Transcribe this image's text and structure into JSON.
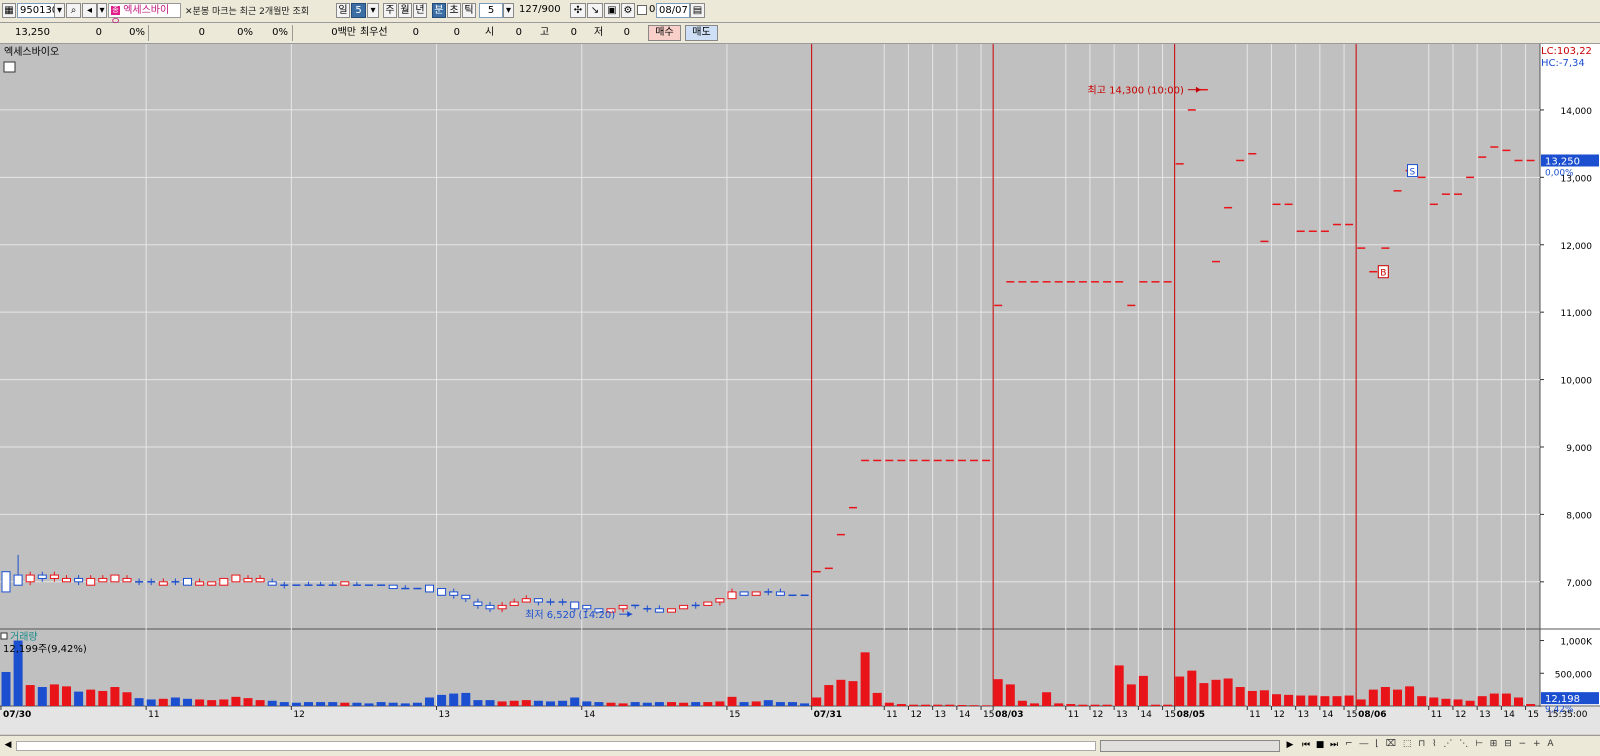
{
  "toolbar": {
    "code": "950130",
    "stock_name": "엑세스바이오",
    "notice": "분봉 마크는 최근 2개월만 조회",
    "period_buttons": [
      "일",
      "5",
      "주",
      "월",
      "년",
      "분",
      "초",
      "틱",
      "5"
    ],
    "count": "127",
    "count_max": "/900",
    "date_check": "0",
    "date": "08/07"
  },
  "infobar": {
    "price": "13,250",
    "f1": "0",
    "f2": "0%",
    "f3": "0",
    "f4": "0%",
    "f5": "0%",
    "f6": "0백만",
    "best_bid_label": "최우선",
    "best_bid": "0",
    "f7": "0",
    "open_label": "시",
    "open": "0",
    "high_label": "고",
    "high": "0",
    "low_label": "저",
    "low": "0",
    "buy_label": "매수",
    "sell_label": "매도"
  },
  "statusbar": {
    "arrow_left": "◀",
    "arrow_right": "▶"
  },
  "colors": {
    "up": "#e8141a",
    "down": "#1c4fd0",
    "bg": "#c0c0c0",
    "grid": "#e6e6e6",
    "day_line": "#c80000"
  },
  "chart_data": {
    "type": "candlestick",
    "interval": "5-minute",
    "title": "엑세스바이오",
    "price_axis": {
      "ticks": [
        7000,
        8000,
        9000,
        10000,
        11000,
        12000,
        13000,
        14000
      ],
      "tick_labels": [
        "7,000",
        "8,000",
        "9,000",
        "10,000",
        "11,000",
        "12,000",
        "13,000",
        "14,000"
      ],
      "range": [
        6300,
        14800
      ]
    },
    "lc_label": "LC:103,22",
    "hc_label": "HC:-7,34",
    "current_price_label": "13,250",
    "current_change_label": "0,00%",
    "annotations": [
      {
        "label": "최고 14,300 (10:00)",
        "value": 14300
      },
      {
        "label": "최저 6,520 (14:20)",
        "value": 6520
      }
    ],
    "markers": [
      {
        "label": "S",
        "value": 13100
      },
      {
        "label": "B",
        "value": 11600
      }
    ],
    "volume_title": "거래량",
    "volume_label": "12,199주(9,42%)",
    "volume_axis": {
      "ticks": [
        500000,
        1000000
      ],
      "tick_labels": [
        "500,000",
        "1,000K"
      ]
    },
    "volume_current_label": "12,198",
    "volume_pct_label": "9,42%",
    "time_label": "15:35:00",
    "x_labels": [
      {
        "i": 0,
        "t": "07/30",
        "day": true
      },
      {
        "i": 12,
        "t": "11"
      },
      {
        "i": 24,
        "t": "12"
      },
      {
        "i": 36,
        "t": "13"
      },
      {
        "i": 48,
        "t": "14"
      },
      {
        "i": 60,
        "t": "15"
      },
      {
        "i": 67,
        "t": "07/31",
        "day": true
      },
      {
        "i": 73,
        "t": "11"
      },
      {
        "i": 75,
        "t": "12"
      },
      {
        "i": 77,
        "t": "13"
      },
      {
        "i": 79,
        "t": "14"
      },
      {
        "i": 81,
        "t": "15"
      },
      {
        "i": 82,
        "t": "08/03",
        "day": true
      },
      {
        "i": 88,
        "t": "11"
      },
      {
        "i": 90,
        "t": "12"
      },
      {
        "i": 92,
        "t": "13"
      },
      {
        "i": 94,
        "t": "14"
      },
      {
        "i": 96,
        "t": "15"
      },
      {
        "i": 97,
        "t": "08/05",
        "day": true
      },
      {
        "i": 103,
        "t": "11"
      },
      {
        "i": 105,
        "t": "12"
      },
      {
        "i": 107,
        "t": "13"
      },
      {
        "i": 109,
        "t": "14"
      },
      {
        "i": 111,
        "t": "15"
      },
      {
        "i": 112,
        "t": "08/06",
        "day": true
      },
      {
        "i": 118,
        "t": "11"
      },
      {
        "i": 120,
        "t": "12"
      },
      {
        "i": 122,
        "t": "13"
      },
      {
        "i": 124,
        "t": "14"
      },
      {
        "i": 126,
        "t": "15"
      }
    ],
    "candles": [
      [
        7150,
        6850,
        7150,
        6850,
        520000
      ],
      [
        7100,
        6950,
        7400,
        6950,
        1000000
      ],
      [
        7000,
        7100,
        7150,
        6950,
        320000
      ],
      [
        7100,
        7050,
        7150,
        7000,
        290000
      ],
      [
        7050,
        7100,
        7150,
        7000,
        330000
      ],
      [
        7000,
        7050,
        7100,
        7000,
        300000
      ],
      [
        7050,
        7000,
        7100,
        6950,
        220000
      ],
      [
        6950,
        7050,
        7100,
        6950,
        250000
      ],
      [
        7000,
        7050,
        7100,
        7000,
        230000
      ],
      [
        7000,
        7100,
        7100,
        7000,
        290000
      ],
      [
        7000,
        7050,
        7100,
        7000,
        210000
      ],
      [
        7000,
        7000,
        7050,
        6950,
        120000
      ],
      [
        7000,
        7000,
        7050,
        6950,
        100000
      ],
      [
        6950,
        7000,
        7050,
        6950,
        110000
      ],
      [
        7000,
        7000,
        7050,
        6950,
        130000
      ],
      [
        7050,
        6950,
        7050,
        6950,
        110000
      ],
      [
        6950,
        7000,
        7050,
        6950,
        100000
      ],
      [
        6950,
        7000,
        7000,
        6950,
        90000
      ],
      [
        6950,
        7050,
        7050,
        6950,
        100000
      ],
      [
        7000,
        7100,
        7100,
        7000,
        140000
      ],
      [
        7000,
        7050,
        7100,
        7000,
        120000
      ],
      [
        7000,
        7050,
        7100,
        7000,
        90000
      ],
      [
        7000,
        6950,
        7050,
        6950,
        80000
      ],
      [
        6950,
        6950,
        7000,
        6900,
        60000
      ],
      [
        6950,
        6950,
        6950,
        6950,
        50000
      ],
      [
        6950,
        6950,
        7000,
        6950,
        60000
      ],
      [
        6950,
        6950,
        7000,
        6950,
        60000
      ],
      [
        6950,
        6950,
        7000,
        6950,
        60000
      ],
      [
        6950,
        7000,
        7000,
        6950,
        50000
      ],
      [
        6950,
        6950,
        7000,
        6950,
        50000
      ],
      [
        6950,
        6950,
        6950,
        6950,
        40000
      ],
      [
        6950,
        6950,
        6950,
        6950,
        60000
      ],
      [
        6950,
        6900,
        6950,
        6900,
        50000
      ],
      [
        6900,
        6900,
        6950,
        6900,
        40000
      ],
      [
        6900,
        6900,
        6900,
        6900,
        50000
      ],
      [
        6950,
        6850,
        6950,
        6850,
        130000
      ],
      [
        6900,
        6800,
        6900,
        6800,
        170000
      ],
      [
        6850,
        6800,
        6900,
        6750,
        190000
      ],
      [
        6800,
        6750,
        6800,
        6700,
        200000
      ],
      [
        6700,
        6650,
        6750,
        6600,
        90000
      ],
      [
        6650,
        6600,
        6700,
        6550,
        90000
      ],
      [
        6600,
        6650,
        6700,
        6550,
        70000
      ],
      [
        6650,
        6700,
        6750,
        6650,
        80000
      ],
      [
        6700,
        6750,
        6800,
        6700,
        90000
      ],
      [
        6750,
        6700,
        6750,
        6650,
        80000
      ],
      [
        6700,
        6700,
        6750,
        6650,
        70000
      ],
      [
        6700,
        6700,
        6750,
        6650,
        80000
      ],
      [
        6700,
        6600,
        6700,
        6550,
        130000
      ],
      [
        6650,
        6600,
        6650,
        6550,
        70000
      ],
      [
        6600,
        6550,
        6600,
        6550,
        60000
      ],
      [
        6550,
        6600,
        6600,
        6550,
        50000
      ],
      [
        6600,
        6650,
        6650,
        6550,
        40000
      ],
      [
        6650,
        6650,
        6650,
        6600,
        60000
      ],
      [
        6600,
        6600,
        6650,
        6550,
        50000
      ],
      [
        6600,
        6550,
        6650,
        6550,
        60000
      ],
      [
        6550,
        6600,
        6600,
        6550,
        60000
      ],
      [
        6600,
        6650,
        6650,
        6600,
        50000
      ],
      [
        6650,
        6650,
        6700,
        6600,
        60000
      ],
      [
        6650,
        6700,
        6700,
        6650,
        60000
      ],
      [
        6700,
        6750,
        6750,
        6650,
        70000
      ],
      [
        6750,
        6850,
        6900,
        6750,
        140000
      ],
      [
        6850,
        6800,
        6850,
        6800,
        60000
      ],
      [
        6800,
        6850,
        6850,
        6800,
        70000
      ],
      [
        6850,
        6850,
        6900,
        6800,
        90000
      ],
      [
        6850,
        6800,
        6900,
        6800,
        60000
      ],
      [
        6800,
        6800,
        6800,
        6800,
        60000
      ],
      [
        6800,
        6800,
        6800,
        6800,
        40000
      ],
      [
        7150,
        7150,
        7150,
        7150,
        130000
      ],
      [
        7200,
        7200,
        7200,
        7200,
        320000
      ],
      [
        7700,
        7700,
        7700,
        7700,
        400000
      ],
      [
        8100,
        8100,
        8100,
        8100,
        380000
      ],
      [
        8800,
        8800,
        8800,
        8800,
        820000
      ],
      [
        8800,
        8800,
        8800,
        8800,
        200000
      ],
      [
        8800,
        8800,
        8800,
        8800,
        50000
      ],
      [
        8800,
        8800,
        8800,
        8800,
        30000
      ],
      [
        8800,
        8800,
        8800,
        8800,
        20000
      ],
      [
        8800,
        8800,
        8800,
        8800,
        20000
      ],
      [
        8800,
        8800,
        8800,
        8800,
        20000
      ],
      [
        8800,
        8800,
        8800,
        8800,
        20000
      ],
      [
        8800,
        8800,
        8800,
        8800,
        15000
      ],
      [
        8800,
        8800,
        8800,
        8800,
        12000
      ],
      [
        8800,
        8800,
        8800,
        8800,
        10000
      ],
      [
        11100,
        11100,
        11100,
        11100,
        410000
      ],
      [
        11450,
        11450,
        11450,
        11450,
        330000
      ],
      [
        11450,
        11450,
        11450,
        11450,
        80000
      ],
      [
        11450,
        11450,
        11450,
        11450,
        40000
      ],
      [
        11450,
        11450,
        11450,
        11450,
        210000
      ],
      [
        11450,
        11450,
        11450,
        11450,
        40000
      ],
      [
        11450,
        11450,
        11450,
        11450,
        30000
      ],
      [
        11450,
        11450,
        11450,
        11450,
        20000
      ],
      [
        11450,
        11450,
        11450,
        11450,
        20000
      ],
      [
        11450,
        11450,
        11450,
        11450,
        20000
      ],
      [
        11450,
        11450,
        11450,
        11450,
        620000
      ],
      [
        11100,
        11100,
        11100,
        11100,
        330000
      ],
      [
        11450,
        11450,
        11450,
        11450,
        460000
      ],
      [
        11450,
        11450,
        11450,
        11450,
        20000
      ],
      [
        11450,
        11450,
        11450,
        11450,
        20000
      ],
      [
        13200,
        13200,
        13200,
        13200,
        450000
      ],
      [
        14000,
        14000,
        14000,
        14000,
        540000
      ],
      [
        14300,
        14300,
        14300,
        14300,
        350000
      ],
      [
        11750,
        11750,
        11750,
        11750,
        400000
      ],
      [
        12550,
        12550,
        12550,
        12550,
        420000
      ],
      [
        13250,
        13250,
        13250,
        13250,
        290000
      ],
      [
        13350,
        13350,
        13350,
        13350,
        230000
      ],
      [
        12050,
        12050,
        12050,
        12050,
        240000
      ],
      [
        12600,
        12600,
        12600,
        12600,
        180000
      ],
      [
        12600,
        12600,
        12600,
        12600,
        170000
      ],
      [
        12200,
        12200,
        12200,
        12200,
        160000
      ],
      [
        12200,
        12200,
        12200,
        12200,
        160000
      ],
      [
        12200,
        12200,
        12200,
        12200,
        150000
      ],
      [
        12300,
        12300,
        12300,
        12300,
        150000
      ],
      [
        12300,
        12300,
        12300,
        12300,
        160000
      ],
      [
        11950,
        11950,
        11950,
        11950,
        100000
      ],
      [
        11600,
        11600,
        11600,
        11600,
        250000
      ],
      [
        11950,
        11950,
        11950,
        11950,
        290000
      ],
      [
        12800,
        12800,
        12800,
        12800,
        250000
      ],
      [
        13100,
        13100,
        13100,
        13100,
        300000
      ],
      [
        13000,
        13000,
        13000,
        13000,
        150000
      ],
      [
        12600,
        12600,
        12600,
        12600,
        130000
      ],
      [
        12750,
        12750,
        12750,
        12750,
        110000
      ],
      [
        12750,
        12750,
        12750,
        12750,
        100000
      ],
      [
        13000,
        13000,
        13000,
        13000,
        80000
      ],
      [
        13300,
        13300,
        13300,
        13300,
        150000
      ],
      [
        13450,
        13450,
        13450,
        13450,
        190000
      ],
      [
        13400,
        13400,
        13400,
        13400,
        190000
      ],
      [
        13250,
        13250,
        13250,
        13250,
        130000
      ],
      [
        13250,
        13250,
        13250,
        13250,
        30000
      ]
    ]
  }
}
